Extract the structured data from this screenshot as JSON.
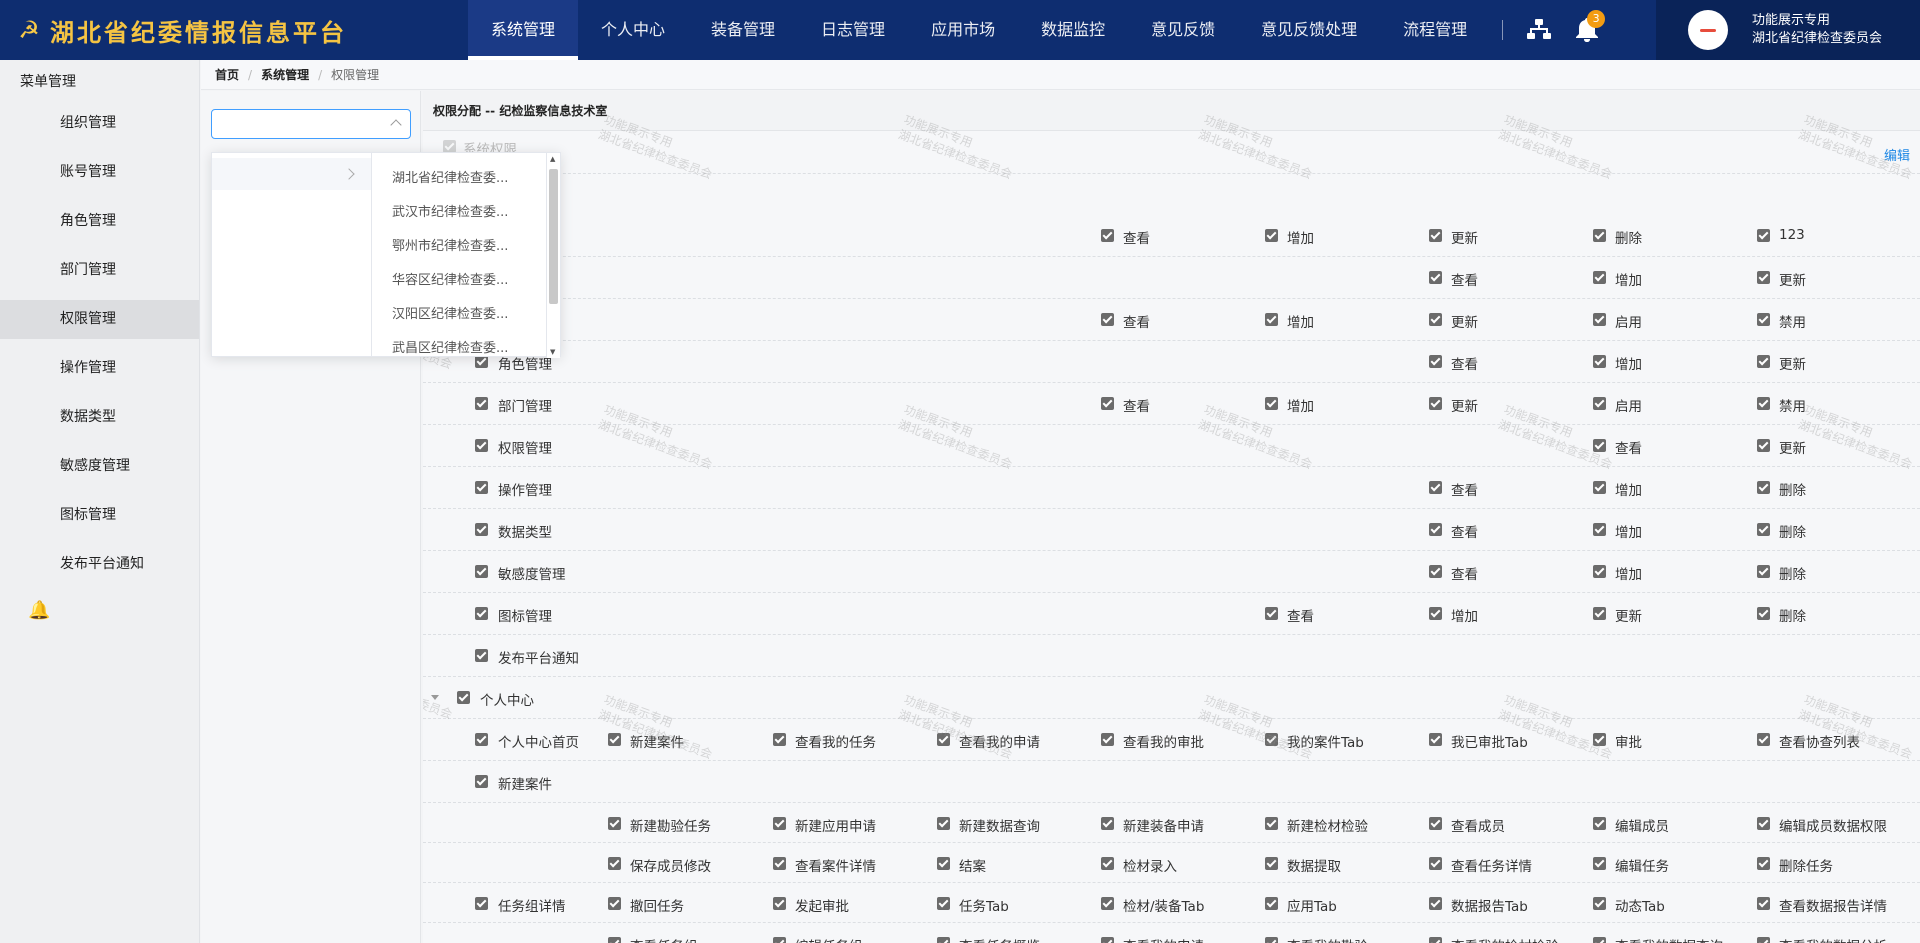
{
  "header": {
    "title": "湖北省纪委情报信息平台",
    "logo_icon": "party-emblem-icon",
    "nav": [
      {
        "label": "系统管理",
        "active": true
      },
      {
        "label": "个人中心"
      },
      {
        "label": "装备管理"
      },
      {
        "label": "日志管理"
      },
      {
        "label": "应用市场"
      },
      {
        "label": "数据监控"
      },
      {
        "label": "意见反馈"
      },
      {
        "label": "意见反馈处理"
      },
      {
        "label": "流程管理"
      }
    ],
    "notification_count": "3",
    "user_line1": "功能展示专用",
    "user_line2": "湖北省纪律检查委员会"
  },
  "sidebar": {
    "group": "菜单管理",
    "items": [
      "组织管理",
      "账号管理",
      "角色管理",
      "部门管理",
      "权限管理",
      "操作管理",
      "数据类型",
      "敏感度管理",
      "图标管理",
      "发布平台通知"
    ],
    "active_index": 4
  },
  "breadcrumb": [
    "首页",
    "系统管理",
    "权限管理"
  ],
  "org_select": {
    "value": "",
    "options": [
      "湖北省纪律检查委...",
      "武汉市纪律检查委...",
      "鄂州市纪律检查委...",
      "华容区纪律检查委...",
      "汉阳区纪律检查委...",
      "武昌区纪律检查委..."
    ]
  },
  "permissions": {
    "title": "权限分配 -- 纪检监察信息技术室",
    "edit_label": "编辑",
    "partial_row_label": "系统权限",
    "rows": [
      {
        "label": "",
        "perms": [
          "查看",
          "增加",
          "更新",
          "删除",
          "123"
        ],
        "cols": [
          4,
          5,
          6,
          7,
          8
        ]
      },
      {
        "label": "",
        "perms": [
          "查看",
          "增加",
          "更新"
        ],
        "cols": [
          6,
          7,
          8
        ]
      },
      {
        "label": "",
        "perms": [
          "查看",
          "增加",
          "更新",
          "启用",
          "禁用"
        ],
        "cols": [
          4,
          5,
          6,
          7,
          8
        ]
      },
      {
        "label": "角色管理",
        "perms": [
          "查看",
          "增加",
          "更新"
        ],
        "cols": [
          6,
          7,
          8
        ]
      },
      {
        "label": "部门管理",
        "perms": [
          "查看",
          "增加",
          "更新",
          "启用",
          "禁用"
        ],
        "cols": [
          4,
          5,
          6,
          7,
          8
        ]
      },
      {
        "label": "权限管理",
        "perms": [
          "查看",
          "更新"
        ],
        "cols": [
          7,
          8
        ]
      },
      {
        "label": "操作管理",
        "perms": [
          "查看",
          "增加",
          "删除"
        ],
        "cols": [
          6,
          7,
          8
        ]
      },
      {
        "label": "数据类型",
        "perms": [
          "查看",
          "增加",
          "删除"
        ],
        "cols": [
          6,
          7,
          8
        ]
      },
      {
        "label": "敏感度管理",
        "perms": [
          "查看",
          "增加",
          "删除"
        ],
        "cols": [
          6,
          7,
          8
        ]
      },
      {
        "label": "图标管理",
        "perms": [
          "查看",
          "增加",
          "更新",
          "删除"
        ],
        "cols": [
          5,
          6,
          7,
          8
        ]
      },
      {
        "label": "发布平台通知",
        "perms": [],
        "cols": []
      },
      {
        "label": "个人中心",
        "perms": [],
        "cols": [],
        "level": 1
      },
      {
        "label": "个人中心首页",
        "perms": [
          "新建案件",
          "查看我的任务",
          "查看我的申请",
          "查看我的审批",
          "我的案件Tab",
          "我已审批Tab",
          "审批",
          "查看协查列表"
        ],
        "cols": [
          1,
          2,
          3,
          4,
          5,
          6,
          7,
          8
        ]
      },
      {
        "label": "新建案件",
        "perms": [],
        "cols": []
      },
      {
        "label": "",
        "perms": [
          "新建勘验任务",
          "新建应用申请",
          "新建数据查询",
          "新建装备申请",
          "新建检材检验",
          "查看成员",
          "编辑成员",
          "编辑成员数据权限"
        ],
        "cols": [
          1,
          2,
          3,
          4,
          5,
          6,
          7,
          8
        ]
      },
      {
        "label": "",
        "perms": [
          "保存成员修改",
          "查看案件详情",
          "结案",
          "检材录入",
          "数据提取",
          "查看任务详情",
          "编辑任务",
          "删除任务"
        ],
        "cols": [
          1,
          2,
          3,
          4,
          5,
          6,
          7,
          8
        ]
      },
      {
        "label": "任务组详情",
        "perms": [
          "撤回任务",
          "发起审批",
          "任务Tab",
          "检材/装备Tab",
          "应用Tab",
          "数据报告Tab",
          "动态Tab",
          "查看数据报告详情"
        ],
        "cols": [
          1,
          2,
          3,
          4,
          5,
          6,
          7,
          8
        ]
      },
      {
        "label": "",
        "perms": [
          "查看任务组",
          "编辑任务组",
          "查看任务概览",
          "查看我的申请",
          "查看我的勘验",
          "查看我的检材检验",
          "查看我的数据查询",
          "查看我的数据分析"
        ],
        "cols": [
          1,
          2,
          3,
          4,
          5,
          6,
          7,
          8
        ]
      }
    ]
  },
  "watermark": {
    "line1": "功能展示专用",
    "line2": "湖北省纪律检查委员会"
  }
}
